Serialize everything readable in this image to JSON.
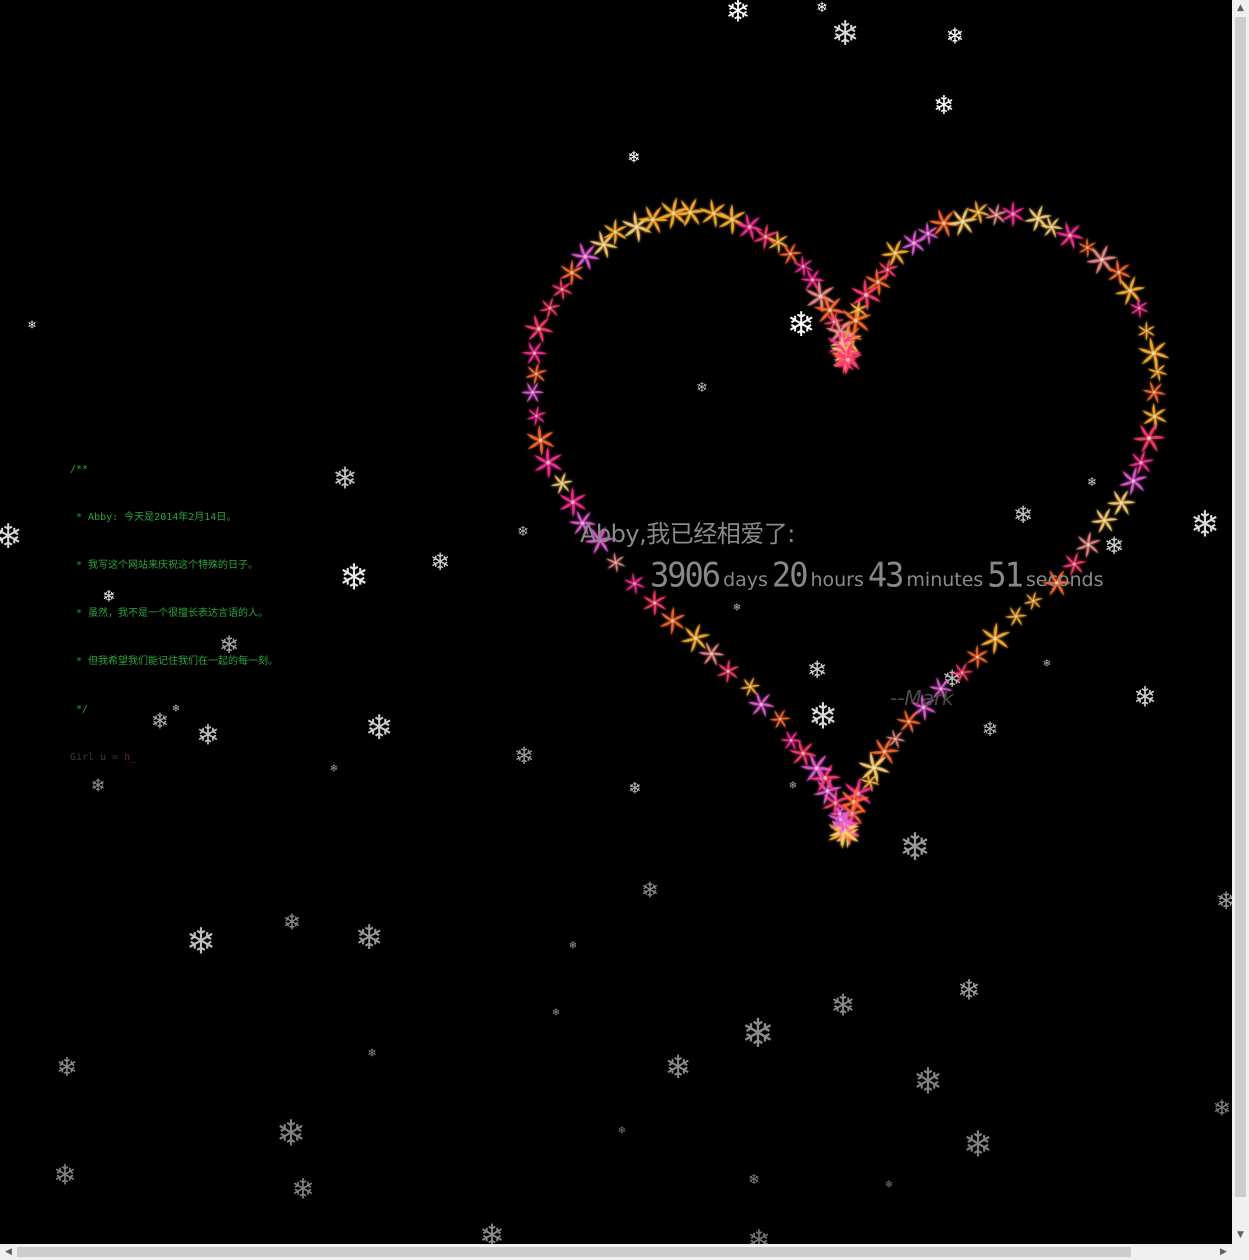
{
  "code": {
    "lines": [
      "/**",
      " * Abby: 今天是2014年2月14日。",
      " * 我写这个网站来庆祝这个特殊的日子。",
      " * 虽然，我不是一个很擅长表达言语的人。",
      " * 但我希望我们能记住我们在一起的每一刻。",
      " */"
    ],
    "girl_prefix": "Girl u = ",
    "girl_keyword": "n_"
  },
  "love": {
    "title": "Abby,我已经相爱了:",
    "days": "3906",
    "days_label": "days",
    "hours": "20",
    "hours_label": "hours",
    "minutes": "43",
    "minutes_label": "minutes",
    "seconds": "51",
    "seconds_label": "seconds",
    "signature": "--Mark"
  },
  "icons": {
    "snowflake": "snowflake-icon",
    "heart_flower": "heart-petal-icon"
  },
  "colors": {
    "background": "#000000",
    "code_text": "#2aa53a",
    "love_text": "#8a8a8a",
    "flower_palette": [
      "#ff3a6e",
      "#ff6a2a",
      "#ffb030",
      "#e85ad8",
      "#ff2a9a",
      "#f08a8a",
      "#ffd070"
    ]
  }
}
